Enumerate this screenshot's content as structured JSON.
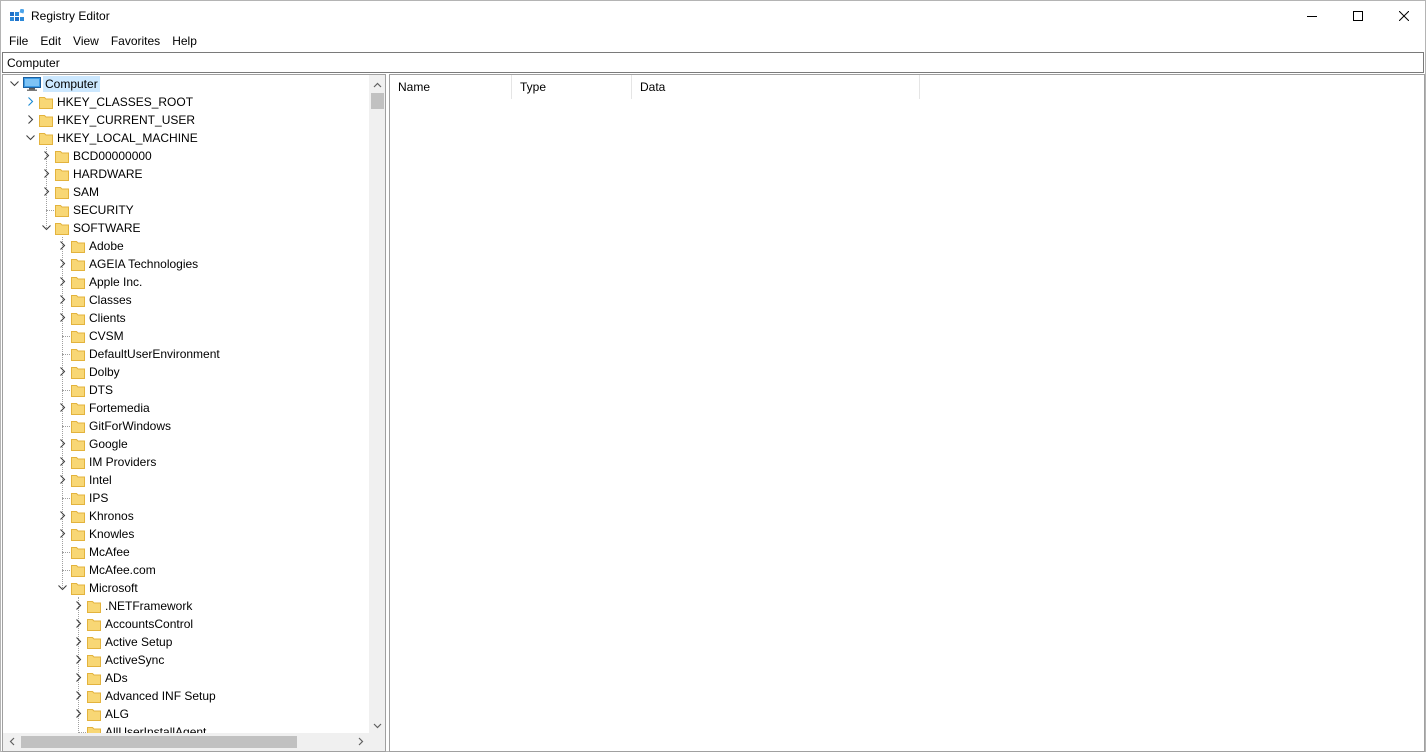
{
  "window": {
    "title": "Registry Editor",
    "controls": {
      "minimize": "minimize-icon",
      "maximize": "maximize-icon",
      "close": "close-icon"
    }
  },
  "menu": [
    "File",
    "Edit",
    "View",
    "Favorites",
    "Help"
  ],
  "address": {
    "value": "Computer"
  },
  "tree": [
    {
      "label": "Computer",
      "level": 0,
      "expander": "expanded",
      "icon": "computer-icon",
      "selected": true
    },
    {
      "label": "HKEY_CLASSES_ROOT",
      "level": 1,
      "expander": "collapsed-hover"
    },
    {
      "label": "HKEY_CURRENT_USER",
      "level": 1,
      "expander": "collapsed"
    },
    {
      "label": "HKEY_LOCAL_MACHINE",
      "level": 1,
      "expander": "expanded"
    },
    {
      "label": "BCD00000000",
      "level": 2,
      "expander": "collapsed"
    },
    {
      "label": "HARDWARE",
      "level": 2,
      "expander": "collapsed"
    },
    {
      "label": "SAM",
      "level": 2,
      "expander": "collapsed"
    },
    {
      "label": "SECURITY",
      "level": 2,
      "expander": "none"
    },
    {
      "label": "SOFTWARE",
      "level": 2,
      "expander": "expanded"
    },
    {
      "label": "Adobe",
      "level": 3,
      "expander": "collapsed"
    },
    {
      "label": "AGEIA Technologies",
      "level": 3,
      "expander": "collapsed"
    },
    {
      "label": "Apple Inc.",
      "level": 3,
      "expander": "collapsed"
    },
    {
      "label": "Classes",
      "level": 3,
      "expander": "collapsed"
    },
    {
      "label": "Clients",
      "level": 3,
      "expander": "collapsed"
    },
    {
      "label": "CVSM",
      "level": 3,
      "expander": "none"
    },
    {
      "label": "DefaultUserEnvironment",
      "level": 3,
      "expander": "none"
    },
    {
      "label": "Dolby",
      "level": 3,
      "expander": "collapsed"
    },
    {
      "label": "DTS",
      "level": 3,
      "expander": "none"
    },
    {
      "label": "Fortemedia",
      "level": 3,
      "expander": "collapsed"
    },
    {
      "label": "GitForWindows",
      "level": 3,
      "expander": "none"
    },
    {
      "label": "Google",
      "level": 3,
      "expander": "collapsed"
    },
    {
      "label": "IM Providers",
      "level": 3,
      "expander": "collapsed"
    },
    {
      "label": "Intel",
      "level": 3,
      "expander": "collapsed"
    },
    {
      "label": "IPS",
      "level": 3,
      "expander": "none"
    },
    {
      "label": "Khronos",
      "level": 3,
      "expander": "collapsed"
    },
    {
      "label": "Knowles",
      "level": 3,
      "expander": "collapsed"
    },
    {
      "label": "McAfee",
      "level": 3,
      "expander": "none"
    },
    {
      "label": "McAfee.com",
      "level": 3,
      "expander": "none"
    },
    {
      "label": "Microsoft",
      "level": 3,
      "expander": "expanded"
    },
    {
      "label": ".NETFramework",
      "level": 4,
      "expander": "collapsed"
    },
    {
      "label": "AccountsControl",
      "level": 4,
      "expander": "collapsed"
    },
    {
      "label": "Active Setup",
      "level": 4,
      "expander": "collapsed"
    },
    {
      "label": "ActiveSync",
      "level": 4,
      "expander": "collapsed"
    },
    {
      "label": "ADs",
      "level": 4,
      "expander": "collapsed"
    },
    {
      "label": "Advanced INF Setup",
      "level": 4,
      "expander": "collapsed"
    },
    {
      "label": "ALG",
      "level": 4,
      "expander": "collapsed"
    },
    {
      "label": "AllUserInstallAgent",
      "level": 4,
      "expander": "none"
    }
  ],
  "values_columns": [
    "Name",
    "Type",
    "Data"
  ],
  "colors": {
    "folder": "#f8d775",
    "folder_edge": "#e3b33d",
    "selection": "#cce8ff",
    "hover_chevron": "#1a8ad4"
  }
}
